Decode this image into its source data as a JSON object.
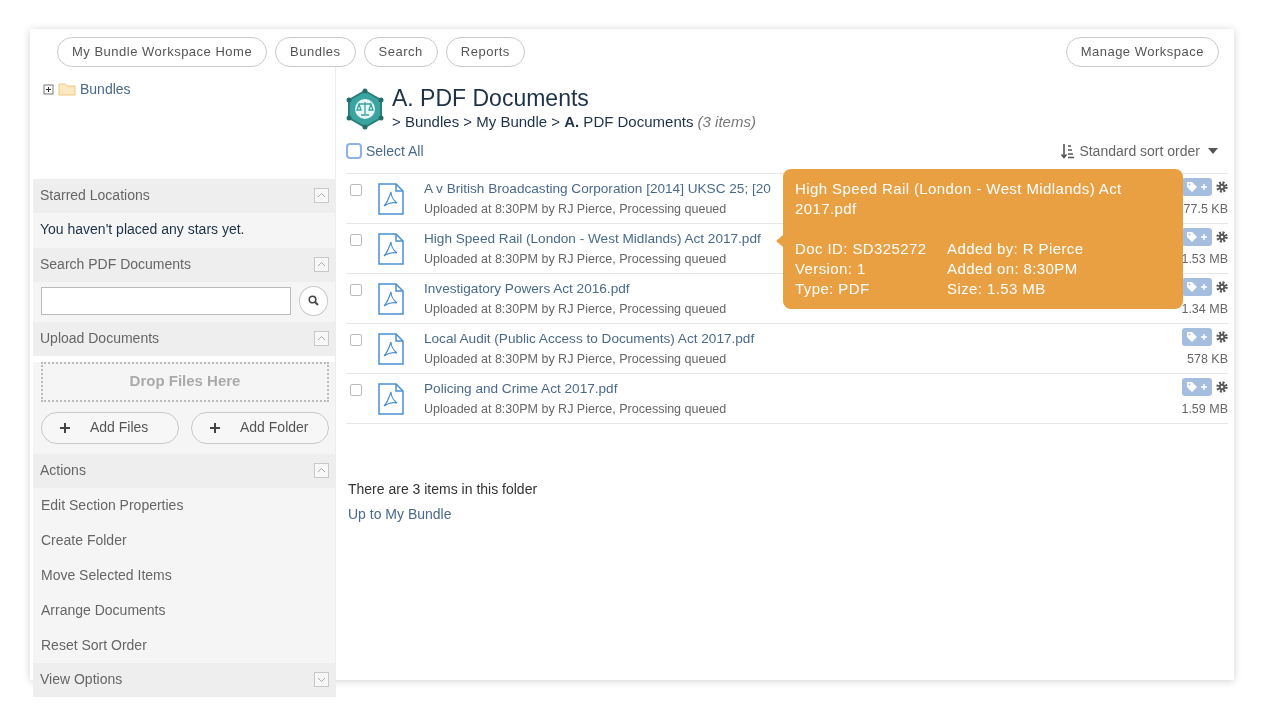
{
  "nav": [
    {
      "label": "My Bundle Workspace Home"
    },
    {
      "label": "Bundles"
    },
    {
      "label": "Search"
    },
    {
      "label": "Reports"
    }
  ],
  "manage_button": "Manage Workspace",
  "tree": [
    {
      "label": "Bundles",
      "expanded": false
    }
  ],
  "sidebar_sections": [
    {
      "title": "Starred Locations",
      "expanded": true,
      "kind": "message",
      "text": "You haven't placed any stars yet."
    },
    {
      "title": "Search PDF Documents",
      "expanded": true,
      "kind": "search"
    },
    {
      "title": "Upload Documents",
      "expanded": true,
      "kind": "upload",
      "dropzone": "Drop Files Here",
      "buttons": [
        "Add Files",
        "Add Folder"
      ]
    },
    {
      "title": "Actions",
      "expanded": true,
      "kind": "links",
      "items": [
        "Edit Section Properties",
        "Create Folder",
        "Move Selected Items",
        "Arrange Documents",
        "Reset Sort Order"
      ]
    },
    {
      "title": "View Options",
      "expanded": false
    }
  ],
  "header": {
    "title": "A. PDF Documents",
    "breadcrumb": "> Bundles > My Bundle > **A.** PDF Documents",
    "count": "(3 items)"
  },
  "select_all": {
    "label": "Select All",
    "checked": false
  },
  "sort": "Standard sort order",
  "documents": [
    {
      "name": "A v British Broadcasting Corporation [2014] UKSC 25;  [20",
      "meta": "Uploaded at 8:30PM by RJ Pierce, Processing queued",
      "size": "77.5 KB",
      "checked": false
    },
    {
      "name": "High Speed Rail (London - West Midlands) Act 2017.pdf",
      "meta": "Uploaded at 8:30PM by RJ Pierce, Processing queued",
      "size": "1.53 MB",
      "checked": false
    },
    {
      "name": "Investigatory Powers Act 2016.pdf",
      "meta": "Uploaded at 8:30PM by RJ Pierce, Processing queued",
      "size": "1.34 MB",
      "checked": false
    },
    {
      "name": "Local Audit (Public Access to Documents) Act 2017.pdf",
      "meta": "Uploaded at 8:30PM by RJ Pierce, Processing queued",
      "size": "578 KB",
      "checked": false
    },
    {
      "name": "Policing and Crime Act 2017.pdf",
      "meta": "Uploaded at 8:30PM by RJ Pierce, Processing queued",
      "size": "1.59 MB",
      "checked": false
    }
  ],
  "tooltip": {
    "title": "High Speed Rail (London - West Midlands) Act 2017.pdf",
    "fields": [
      "Doc ID: SD325272",
      "Added by: R Pierce",
      "Version: 1",
      "Added on: 8:30PM",
      "Type: PDF",
      "Size: 1.53 MB"
    ]
  },
  "summary": "There are 3 items in this folder",
  "up_link": "Up to My Bundle"
}
